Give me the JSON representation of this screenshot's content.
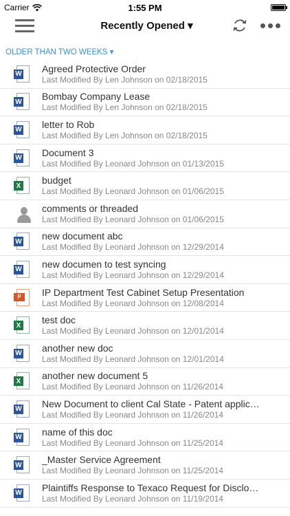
{
  "status_bar": {
    "carrier": "Carrier",
    "time": "1:55 PM"
  },
  "navbar": {
    "title": "Recently Opened ▾"
  },
  "section": {
    "header": "OLDER THAN TWO WEEKS ▾"
  },
  "documents": [
    {
      "name": "Agreed Protective Order",
      "meta": "Last Modified By Len Johnson on 02/18/2015",
      "type": "word"
    },
    {
      "name": "Bombay Company Lease",
      "meta": "Last Modified By Len Johnson on 02/18/2015",
      "type": "word"
    },
    {
      "name": "letter to Rob",
      "meta": "Last Modified By Len Johnson on 02/18/2015",
      "type": "word"
    },
    {
      "name": "Document 3",
      "meta": "Last Modified By Leonard Johnson on 01/13/2015",
      "type": "word"
    },
    {
      "name": "budget",
      "meta": "Last Modified By Leonard Johnson on 01/06/2015",
      "type": "excel"
    },
    {
      "name": "comments or threaded",
      "meta": "Last Modified By Leonard Johnson on 01/06/2015",
      "type": "person"
    },
    {
      "name": "new document abc",
      "meta": "Last Modified By Leonard Johnson on 12/29/2014",
      "type": "word"
    },
    {
      "name": "new documen to test syncing",
      "meta": "Last Modified By Leonard Johnson on 12/29/2014",
      "type": "word"
    },
    {
      "name": "IP Department Test Cabinet Setup Presentation",
      "meta": "Last Modified By Leonard Johnson on 12/08/2014",
      "type": "ppt"
    },
    {
      "name": "test doc",
      "meta": "Last Modified By Leonard Johnson on 12/01/2014",
      "type": "excel"
    },
    {
      "name": "another new doc",
      "meta": "Last Modified By Leonard Johnson on 12/01/2014",
      "type": "word"
    },
    {
      "name": "another new document 5",
      "meta": "Last Modified By Leonard Johnson on 11/26/2014",
      "type": "excel"
    },
    {
      "name": "New Document to client Cal State - Patent applic…",
      "meta": "Last Modified By Leonard Johnson on 11/26/2014",
      "type": "word"
    },
    {
      "name": "name of this doc",
      "meta": "Last Modified By Leonard Johnson on 11/25/2014",
      "type": "word"
    },
    {
      "name": "_Master Service Agreement",
      "meta": "Last Modified By Leonard Johnson on 11/25/2014",
      "type": "word"
    },
    {
      "name": "Plaintiffs Response to Texaco Request for Disclo…",
      "meta": "Last Modified By Leonard Johnson on 11/19/2014",
      "type": "word"
    }
  ],
  "icons": {
    "word": "W",
    "excel": "X",
    "ppt": "P"
  },
  "colors": {
    "accent": "#3a8fd6",
    "word": "#2b579a",
    "excel": "#1f7a45",
    "ppt": "#d4572a"
  }
}
